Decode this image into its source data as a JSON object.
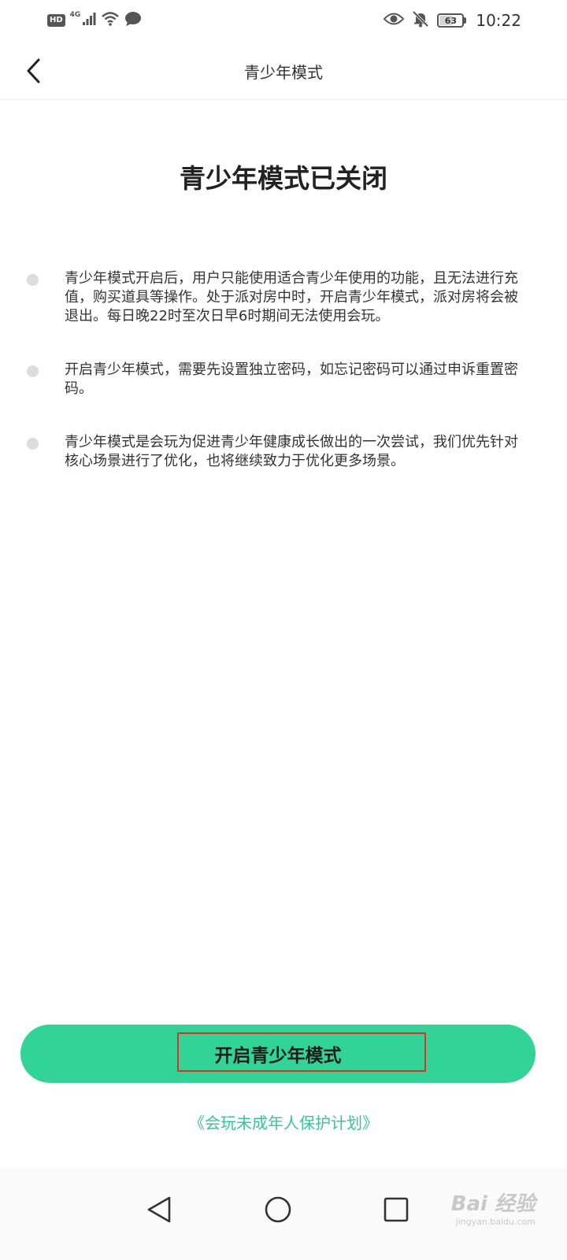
{
  "status_bar": {
    "hd": "HD",
    "network": "4G",
    "battery": "63",
    "battery_level": 0.63,
    "time": "10:22",
    "icons": [
      "signal-icon",
      "wifi-icon",
      "chat-icon",
      "eye-icon",
      "mute-bell-icon",
      "battery-icon"
    ]
  },
  "app_bar": {
    "title": "青少年模式"
  },
  "main": {
    "heading": "青少年模式已关闭",
    "notices": [
      "青少年模式开启后，用户只能使用适合青少年使用的功能，且无法进行充值，购买道具等操作。处于派对房中时，开启青少年模式，派对房将会被退出。每日晚22时至次日早6时期间无法使用会玩。",
      "开启青少年模式，需要先设置独立密码，如忘记密码可以通过申诉重置密码。",
      "青少年模式是会玩为促进青少年健康成长做出的一次尝试，我们优先针对核心场景进行了优化，也将继续致力于优化更多场景。"
    ]
  },
  "actions": {
    "enable_label": "开启青少年模式",
    "protection_link": "《会玩未成年人保护计划》"
  },
  "colors": {
    "accent": "#31d396",
    "link": "#3ac393",
    "highlight": "#d9342b"
  },
  "watermark": {
    "logo": "Bai 经验",
    "site": "jingyan.baidu.com"
  }
}
